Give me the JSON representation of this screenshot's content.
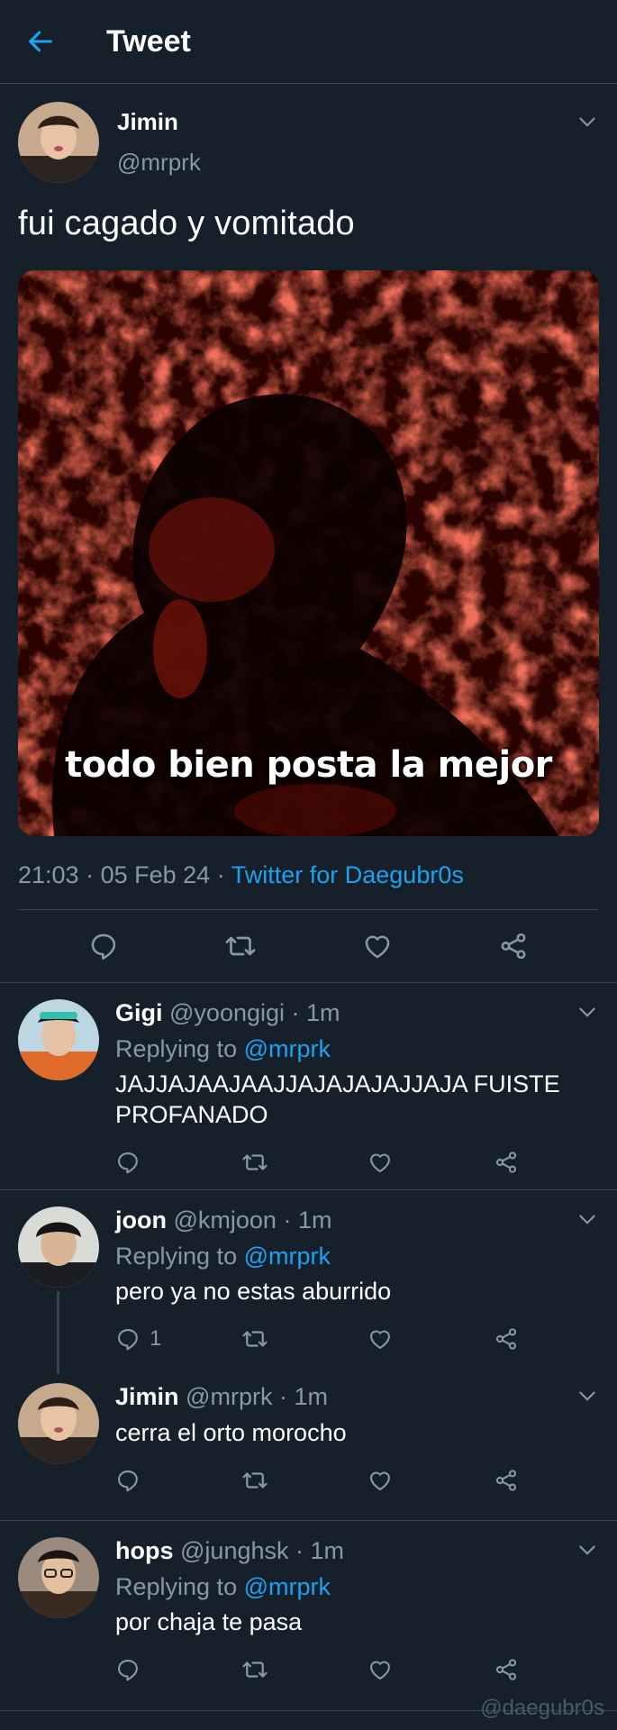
{
  "header": {
    "title": "Tweet"
  },
  "tweet": {
    "author_name": "Jimin",
    "author_handle": "@mrprk",
    "text": "fui cagado y vomitado",
    "media_caption": "todo bien posta la mejor",
    "time": "21:03",
    "date": "05 Feb 24",
    "source": "Twitter for Daegubr0s",
    "sep": "·"
  },
  "replies": [
    {
      "name": "Gigi",
      "handle": "@yoongigi",
      "age": "· 1m",
      "replying_label": "Replying to",
      "replying_to": "@mrprk",
      "text": "JAJJAJAAJAAJJAJAJAJAJJAJA FUISTE PROFANADO",
      "reply_count": ""
    },
    {
      "name": "joon",
      "handle": "@kmjoon",
      "age": "· 1m",
      "replying_label": "Replying to",
      "replying_to": "@mrprk",
      "text": "pero ya no estas aburrido",
      "reply_count": "1"
    },
    {
      "name": "Jimin",
      "handle": "@mrprk",
      "age": "· 1m",
      "text": "cerra el orto morocho",
      "reply_count": ""
    },
    {
      "name": "hops",
      "handle": "@junghsk",
      "age": "· 1m",
      "replying_label": "Replying to",
      "replying_to": "@mrprk",
      "text": "por chaja te pasa",
      "reply_count": ""
    }
  ],
  "watermark": "@daegubr0s",
  "colors": {
    "background": "#15202b",
    "accent": "#1da1f2",
    "muted": "#8899a6",
    "divider": "#38444d"
  },
  "icons": [
    "back-arrow-icon",
    "chevron-down-icon",
    "reply-icon",
    "retweet-icon",
    "like-icon",
    "share-icon"
  ]
}
